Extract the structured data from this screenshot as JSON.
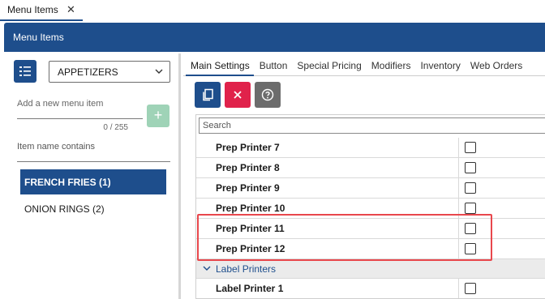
{
  "doc_tab": {
    "label": "Menu Items",
    "close_glyph": "✕"
  },
  "header": {
    "title": "Menu Items"
  },
  "left_panel": {
    "category": {
      "selected": "APPETIZERS"
    },
    "new_item": {
      "placeholder": "Add a new menu item",
      "counter": "0 / 255",
      "add_glyph": "+"
    },
    "filter": {
      "label": "Item name contains"
    },
    "items": [
      {
        "label": "FRENCH FRIES (1)",
        "selected": true
      },
      {
        "label": "ONION RINGS (2)",
        "selected": false
      }
    ]
  },
  "tabs": [
    {
      "label": "Main Settings",
      "active": true
    },
    {
      "label": "Button",
      "active": false
    },
    {
      "label": "Special Pricing",
      "active": false
    },
    {
      "label": "Modifiers",
      "active": false
    },
    {
      "label": "Inventory",
      "active": false
    },
    {
      "label": "Web Orders",
      "active": false
    }
  ],
  "toolbar": {
    "icons": [
      "copy-icon",
      "delete-icon",
      "help-icon"
    ]
  },
  "grid": {
    "search_placeholder": "Search",
    "rows": [
      {
        "name": "Prep Printer 7",
        "checked": false
      },
      {
        "name": "Prep Printer 8",
        "checked": false
      },
      {
        "name": "Prep Printer 9",
        "checked": false
      },
      {
        "name": "Prep Printer 10",
        "checked": false
      },
      {
        "name": "Prep Printer 11",
        "checked": false
      },
      {
        "name": "Prep Printer 12",
        "checked": false
      }
    ],
    "group": {
      "label": "Label Printers"
    },
    "group_rows": [
      {
        "name": "Label Printer 1",
        "checked": false
      }
    ]
  },
  "colors": {
    "brand": "#1e4e8c",
    "danger": "#e0224b",
    "neutral": "#6c6c6c",
    "add": "#9fd3b7",
    "highlight": "#e8474c"
  }
}
